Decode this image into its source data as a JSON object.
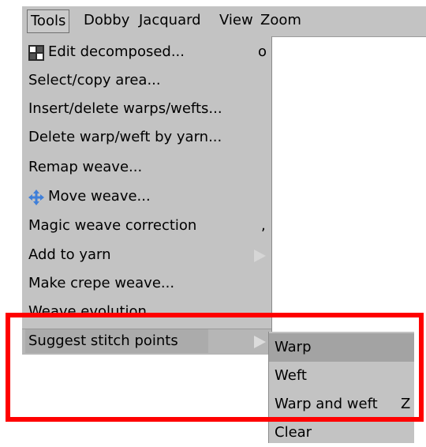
{
  "menubar": {
    "items": [
      "Tools",
      "Dobby",
      "Jacquard",
      "View",
      "Zoom"
    ]
  },
  "tools_menu": {
    "items": [
      {
        "label": "Edit decomposed...",
        "shortcut": "o",
        "icon": "checkerboard-icon"
      },
      {
        "label": "Select/copy area..."
      },
      {
        "label": "Insert/delete warps/wefts..."
      },
      {
        "label": "Delete warp/weft by yarn..."
      },
      {
        "label": "Remap weave..."
      },
      {
        "label": "Move weave...",
        "icon": "move-arrows-icon"
      },
      {
        "label": "Magic weave correction",
        "shortcut": ","
      },
      {
        "label": "Add to yarn",
        "submenu": true
      },
      {
        "label": "Make crepe weave..."
      },
      {
        "label": "Weave evolution..."
      },
      {
        "label": "Suggest stitch points",
        "submenu": true,
        "active": true
      }
    ]
  },
  "submenu": {
    "items": [
      {
        "label": "Warp",
        "selected": true
      },
      {
        "label": "Weft"
      },
      {
        "label": "Warp and weft",
        "shortcut": "Z"
      },
      {
        "label": "Clear"
      }
    ]
  },
  "colors": {
    "menu_bg": "#c3c3c3",
    "annotation_box": "#ff0000",
    "icon_blue": "#3f7fd9"
  }
}
